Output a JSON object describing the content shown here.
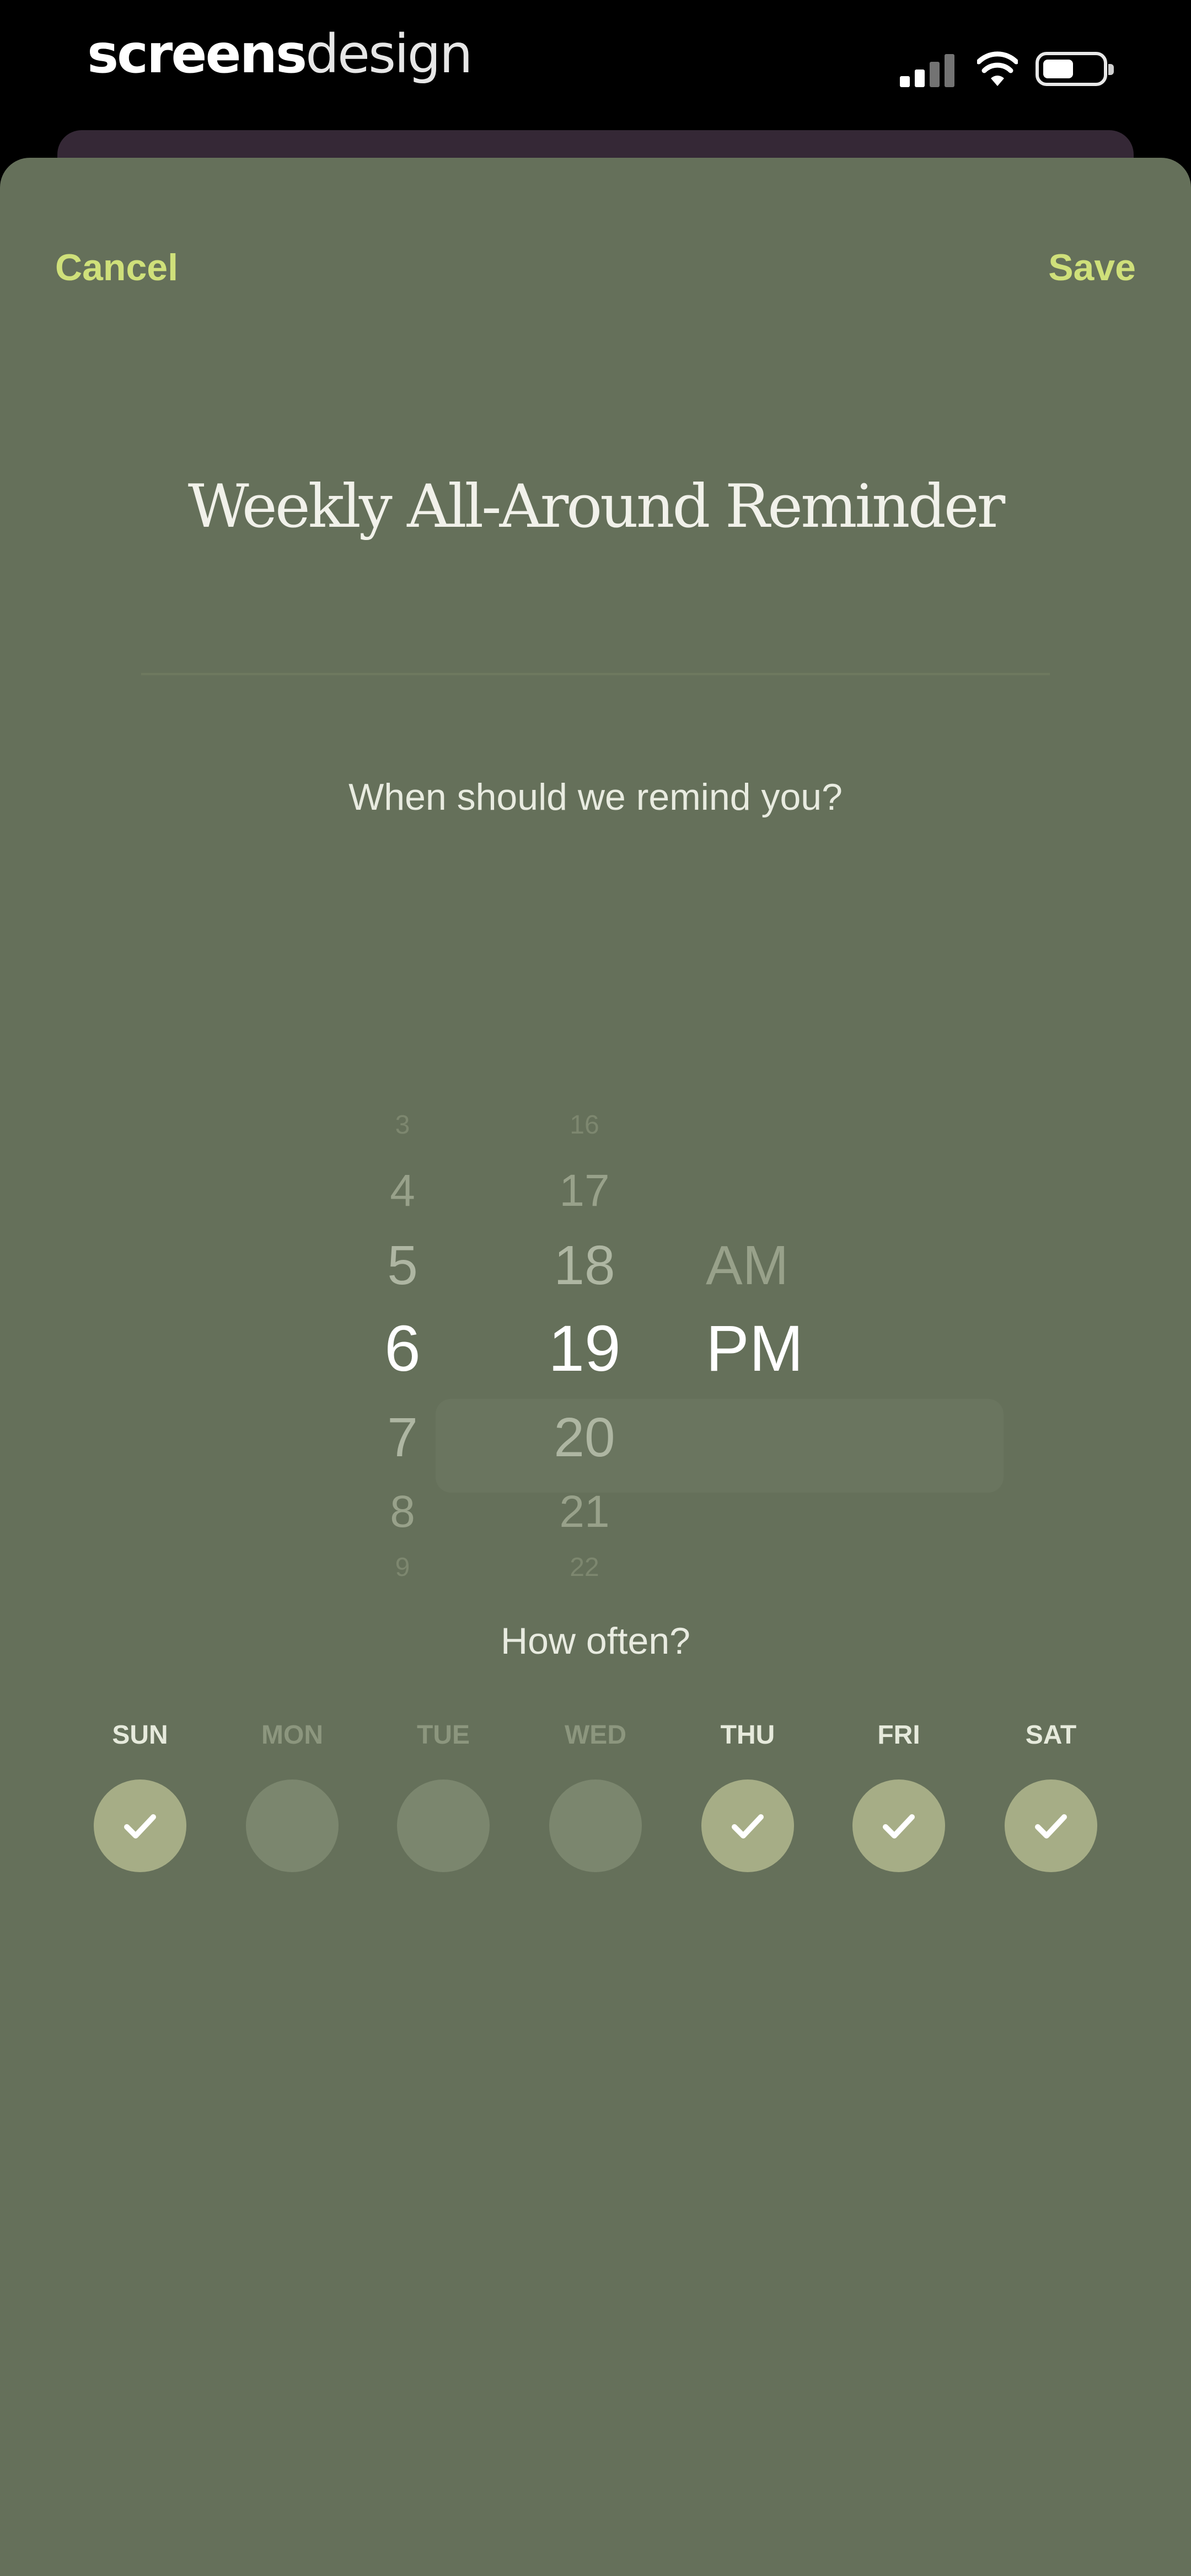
{
  "status_bar": {
    "brand_bold": "screens",
    "brand_light": "design"
  },
  "sheet": {
    "cancel_label": "Cancel",
    "save_label": "Save",
    "title": "Weekly All-Around Reminder",
    "question": "When should we remind you?",
    "how_often": "How often?"
  },
  "picker": {
    "hours": [
      "3",
      "4",
      "5",
      "6",
      "7",
      "8",
      "9"
    ],
    "minutes": [
      "16",
      "17",
      "18",
      "19",
      "20",
      "21",
      "22"
    ],
    "periods": [
      "AM",
      "PM"
    ],
    "selected": {
      "hour": "6",
      "minute": "19",
      "period": "PM"
    }
  },
  "days": [
    {
      "label": "SUN",
      "checked": true
    },
    {
      "label": "MON",
      "checked": false
    },
    {
      "label": "TUE",
      "checked": false
    },
    {
      "label": "WED",
      "checked": false
    },
    {
      "label": "THU",
      "checked": true
    },
    {
      "label": "FRI",
      "checked": true
    },
    {
      "label": "SAT",
      "checked": true
    }
  ],
  "icons": {
    "signal": "signal-icon",
    "wifi": "wifi-icon",
    "battery": "battery-icon",
    "check": "check-icon"
  },
  "colors": {
    "sheet": "#65705a",
    "accent": "#cfe07a",
    "day_on": "#a6ad86",
    "day_off": "#7b866e"
  }
}
